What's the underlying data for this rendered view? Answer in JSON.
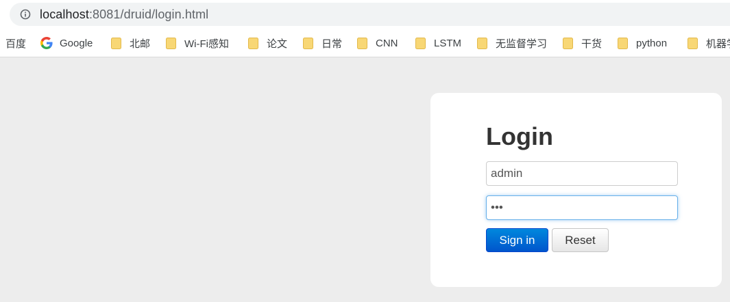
{
  "browser": {
    "url_host": "localhost",
    "url_rest": ":8081/druid/login.html"
  },
  "bookmarks": [
    {
      "label": "百度",
      "icon": "none"
    },
    {
      "label": "Google",
      "icon": "google-icon"
    },
    {
      "label": "北邮",
      "icon": "folder-icon"
    },
    {
      "label": "Wi-Fi感知",
      "icon": "folder-icon"
    },
    {
      "label": "论文",
      "icon": "folder-icon"
    },
    {
      "label": "日常",
      "icon": "folder-icon"
    },
    {
      "label": "CNN",
      "icon": "folder-icon"
    },
    {
      "label": "LSTM",
      "icon": "folder-icon"
    },
    {
      "label": "无监督学习",
      "icon": "folder-icon"
    },
    {
      "label": "干货",
      "icon": "folder-icon"
    },
    {
      "label": "python",
      "icon": "folder-icon"
    },
    {
      "label": "机器学",
      "icon": "folder-icon"
    }
  ],
  "login": {
    "title": "Login",
    "username_value": "admin",
    "password_value": "•••",
    "signin_label": "Sign in",
    "reset_label": "Reset"
  },
  "colors": {
    "background": "#ededed",
    "primary_button": "#0066cc",
    "folder": "#f8d775"
  }
}
